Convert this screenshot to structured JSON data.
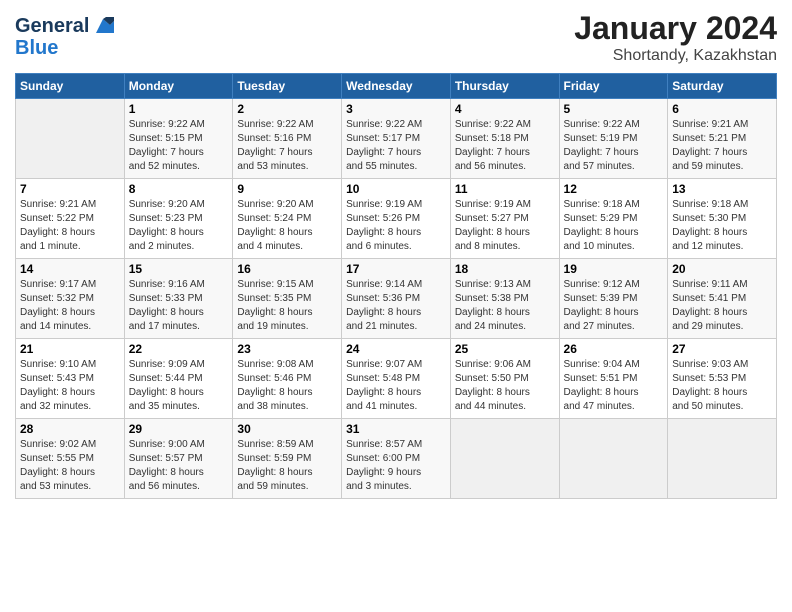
{
  "header": {
    "logo_general": "General",
    "logo_blue": "Blue",
    "month_year": "January 2024",
    "location": "Shortandy, Kazakhstan"
  },
  "days_of_week": [
    "Sunday",
    "Monday",
    "Tuesday",
    "Wednesday",
    "Thursday",
    "Friday",
    "Saturday"
  ],
  "weeks": [
    [
      {
        "day": "",
        "info": ""
      },
      {
        "day": "1",
        "info": "Sunrise: 9:22 AM\nSunset: 5:15 PM\nDaylight: 7 hours\nand 52 minutes."
      },
      {
        "day": "2",
        "info": "Sunrise: 9:22 AM\nSunset: 5:16 PM\nDaylight: 7 hours\nand 53 minutes."
      },
      {
        "day": "3",
        "info": "Sunrise: 9:22 AM\nSunset: 5:17 PM\nDaylight: 7 hours\nand 55 minutes."
      },
      {
        "day": "4",
        "info": "Sunrise: 9:22 AM\nSunset: 5:18 PM\nDaylight: 7 hours\nand 56 minutes."
      },
      {
        "day": "5",
        "info": "Sunrise: 9:22 AM\nSunset: 5:19 PM\nDaylight: 7 hours\nand 57 minutes."
      },
      {
        "day": "6",
        "info": "Sunrise: 9:21 AM\nSunset: 5:21 PM\nDaylight: 7 hours\nand 59 minutes."
      }
    ],
    [
      {
        "day": "7",
        "info": "Sunrise: 9:21 AM\nSunset: 5:22 PM\nDaylight: 8 hours\nand 1 minute."
      },
      {
        "day": "8",
        "info": "Sunrise: 9:20 AM\nSunset: 5:23 PM\nDaylight: 8 hours\nand 2 minutes."
      },
      {
        "day": "9",
        "info": "Sunrise: 9:20 AM\nSunset: 5:24 PM\nDaylight: 8 hours\nand 4 minutes."
      },
      {
        "day": "10",
        "info": "Sunrise: 9:19 AM\nSunset: 5:26 PM\nDaylight: 8 hours\nand 6 minutes."
      },
      {
        "day": "11",
        "info": "Sunrise: 9:19 AM\nSunset: 5:27 PM\nDaylight: 8 hours\nand 8 minutes."
      },
      {
        "day": "12",
        "info": "Sunrise: 9:18 AM\nSunset: 5:29 PM\nDaylight: 8 hours\nand 10 minutes."
      },
      {
        "day": "13",
        "info": "Sunrise: 9:18 AM\nSunset: 5:30 PM\nDaylight: 8 hours\nand 12 minutes."
      }
    ],
    [
      {
        "day": "14",
        "info": "Sunrise: 9:17 AM\nSunset: 5:32 PM\nDaylight: 8 hours\nand 14 minutes."
      },
      {
        "day": "15",
        "info": "Sunrise: 9:16 AM\nSunset: 5:33 PM\nDaylight: 8 hours\nand 17 minutes."
      },
      {
        "day": "16",
        "info": "Sunrise: 9:15 AM\nSunset: 5:35 PM\nDaylight: 8 hours\nand 19 minutes."
      },
      {
        "day": "17",
        "info": "Sunrise: 9:14 AM\nSunset: 5:36 PM\nDaylight: 8 hours\nand 21 minutes."
      },
      {
        "day": "18",
        "info": "Sunrise: 9:13 AM\nSunset: 5:38 PM\nDaylight: 8 hours\nand 24 minutes."
      },
      {
        "day": "19",
        "info": "Sunrise: 9:12 AM\nSunset: 5:39 PM\nDaylight: 8 hours\nand 27 minutes."
      },
      {
        "day": "20",
        "info": "Sunrise: 9:11 AM\nSunset: 5:41 PM\nDaylight: 8 hours\nand 29 minutes."
      }
    ],
    [
      {
        "day": "21",
        "info": "Sunrise: 9:10 AM\nSunset: 5:43 PM\nDaylight: 8 hours\nand 32 minutes."
      },
      {
        "day": "22",
        "info": "Sunrise: 9:09 AM\nSunset: 5:44 PM\nDaylight: 8 hours\nand 35 minutes."
      },
      {
        "day": "23",
        "info": "Sunrise: 9:08 AM\nSunset: 5:46 PM\nDaylight: 8 hours\nand 38 minutes."
      },
      {
        "day": "24",
        "info": "Sunrise: 9:07 AM\nSunset: 5:48 PM\nDaylight: 8 hours\nand 41 minutes."
      },
      {
        "day": "25",
        "info": "Sunrise: 9:06 AM\nSunset: 5:50 PM\nDaylight: 8 hours\nand 44 minutes."
      },
      {
        "day": "26",
        "info": "Sunrise: 9:04 AM\nSunset: 5:51 PM\nDaylight: 8 hours\nand 47 minutes."
      },
      {
        "day": "27",
        "info": "Sunrise: 9:03 AM\nSunset: 5:53 PM\nDaylight: 8 hours\nand 50 minutes."
      }
    ],
    [
      {
        "day": "28",
        "info": "Sunrise: 9:02 AM\nSunset: 5:55 PM\nDaylight: 8 hours\nand 53 minutes."
      },
      {
        "day": "29",
        "info": "Sunrise: 9:00 AM\nSunset: 5:57 PM\nDaylight: 8 hours\nand 56 minutes."
      },
      {
        "day": "30",
        "info": "Sunrise: 8:59 AM\nSunset: 5:59 PM\nDaylight: 8 hours\nand 59 minutes."
      },
      {
        "day": "31",
        "info": "Sunrise: 8:57 AM\nSunset: 6:00 PM\nDaylight: 9 hours\nand 3 minutes."
      },
      {
        "day": "",
        "info": ""
      },
      {
        "day": "",
        "info": ""
      },
      {
        "day": "",
        "info": ""
      }
    ]
  ]
}
